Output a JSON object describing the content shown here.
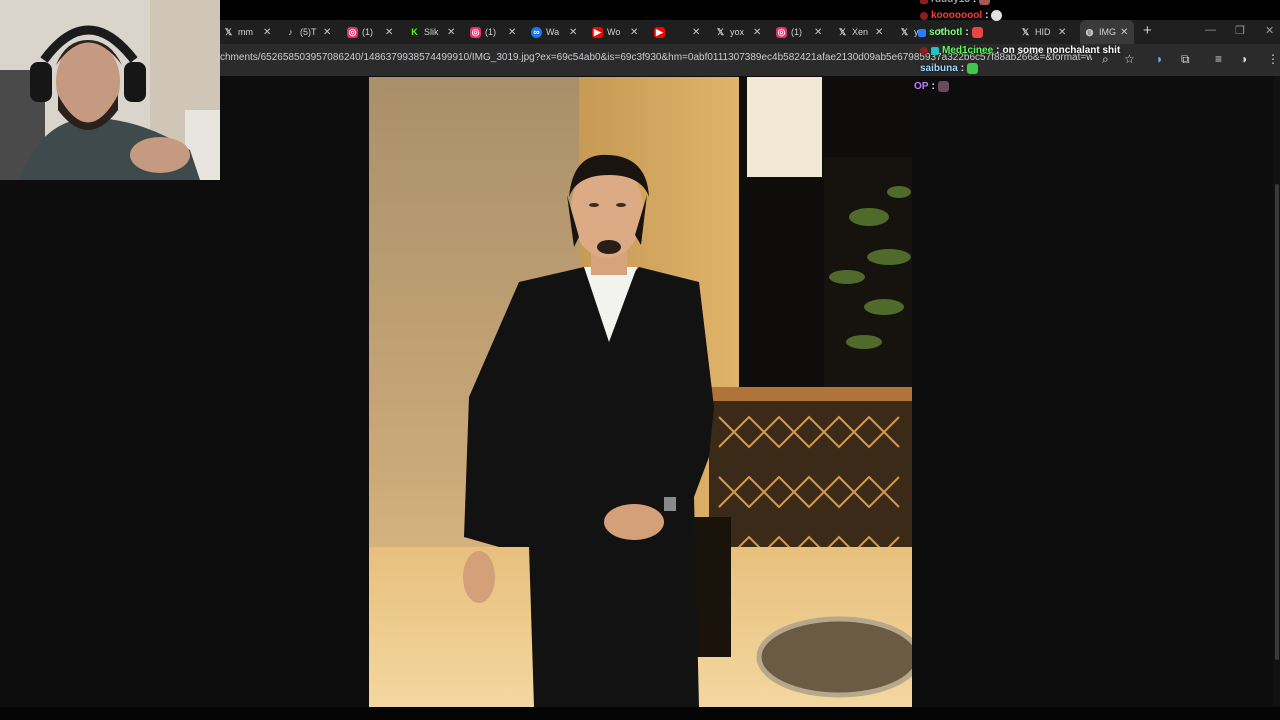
{
  "browser": {
    "tabs": [
      {
        "icon": "x-logo-icon",
        "title": "mm",
        "color": "#ffffff"
      },
      {
        "icon": "tiktok-icon",
        "title": "(5)T",
        "color": "#ffffff"
      },
      {
        "icon": "instagram-icon",
        "title": "(1)",
        "color": "#e1306c"
      },
      {
        "icon": "kick-icon",
        "title": "Slik",
        "color": "#53fc18"
      },
      {
        "icon": "instagram-icon",
        "title": "(1)",
        "color": "#e1306c"
      },
      {
        "icon": "meta-icon",
        "title": "Wa",
        "color": "#1877f2"
      },
      {
        "icon": "youtube-icon",
        "title": "Wo",
        "color": "#ff0000"
      },
      {
        "icon": "youtube-icon",
        "title": "",
        "color": "#ff0000"
      },
      {
        "icon": "x-logo-icon",
        "title": "yox",
        "color": "#ffffff"
      },
      {
        "icon": "instagram-icon",
        "title": "(1)",
        "color": "#e1306c"
      },
      {
        "icon": "x-logo-icon",
        "title": "Xen",
        "color": "#ffffff"
      },
      {
        "icon": "x-logo-icon",
        "title": "y",
        "color": "#ffffff"
      },
      {
        "icon": "x-logo-icon",
        "title": "HID",
        "color": "#ffffff"
      },
      {
        "icon": "globe-icon",
        "title": "IMG",
        "color": "#cfcfcf",
        "active": true
      }
    ],
    "new_tab_label": "+",
    "url": "chments/652658503957086240/1486379938574499910/IMG_3019.jpg?ex=69c54ab0&is=69c3f930&hm=0abf0111307389ec4b582421afae2130d09ab5e67985937a322b6c57f88ab266&=&format=webp&width=4..."
  },
  "chat": {
    "lines": [
      {
        "user": "ruuuy13",
        "message": "",
        "color": "#9aa0a6"
      },
      {
        "user": "koooooool",
        "message": "",
        "color": "#ff3b3b"
      },
      {
        "user": "sothotl",
        "message": "",
        "color": "#7fff7f"
      },
      {
        "user": "Med1cinee",
        "message": "on some nonchalant shit",
        "color": "#5cff5c"
      },
      {
        "user": "saibuna",
        "message": "",
        "color": "#9fd8ff"
      },
      {
        "user": "OP",
        "message": "",
        "color": "#c77dff"
      }
    ]
  }
}
